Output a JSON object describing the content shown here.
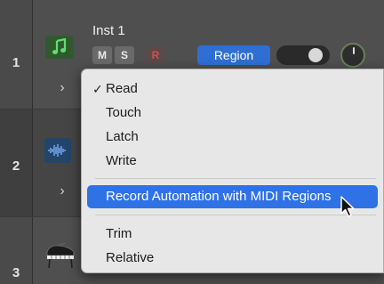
{
  "tracks": [
    {
      "number": "1",
      "name": "Inst 1",
      "type": "software-instrument"
    },
    {
      "number": "2",
      "type": "audio"
    },
    {
      "number": "3",
      "type": "piano"
    }
  ],
  "track1_controls": {
    "mute_label": "M",
    "solo_label": "S",
    "record_label": "R",
    "automation_mode_label": "Region"
  },
  "menu": {
    "items": [
      {
        "label": "Read",
        "checked": true
      },
      {
        "label": "Touch"
      },
      {
        "label": "Latch"
      },
      {
        "label": "Write"
      },
      {
        "label": "Record Automation with MIDI Regions",
        "highlighted": true
      },
      {
        "label": "Trim"
      },
      {
        "label": "Relative"
      }
    ],
    "check_glyph": "✓"
  },
  "icons": {
    "instrument": "music-note-icon",
    "audio": "waveform-icon",
    "piano": "grand-piano-icon",
    "disclosure": "chevron-right-icon",
    "cursor": "mouse-pointer-icon"
  },
  "colors": {
    "region_button": "#2f6fd4",
    "menu_highlight": "#2f72e6",
    "record_text": "#e0484a"
  }
}
